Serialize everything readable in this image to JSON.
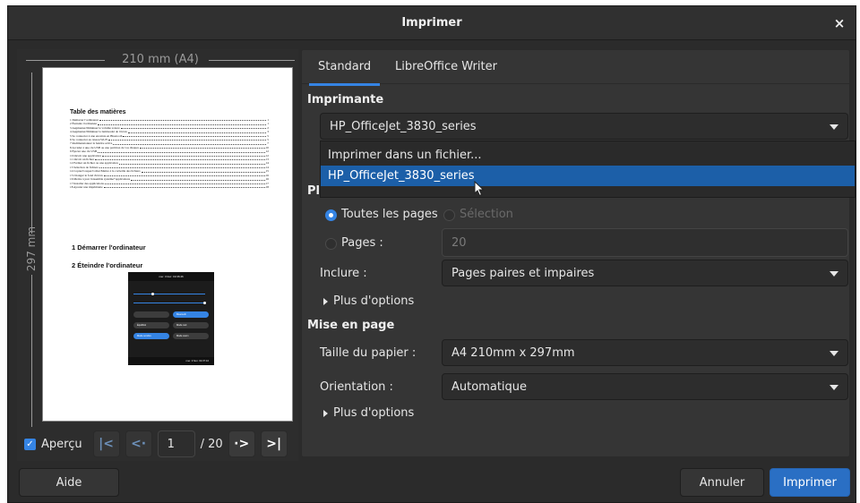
{
  "dialog": {
    "title": "Imprimer",
    "close_glyph": "×"
  },
  "preview": {
    "width_label": "210 mm (A4)",
    "height_label": "297 mm",
    "doc": {
      "toc_title": "Table des matières",
      "toc": [
        {
          "t": "1  Démarrer l'ordinateur",
          "p": "1"
        },
        {
          "t": "2  Éteindre l'ordinateur",
          "p": "1"
        },
        {
          "t": "3  Augmenter/Diminuer le volume sonore",
          "p": "2"
        },
        {
          "t": "4  Augmenter/Diminuer la luminosité de l'écran",
          "p": "3"
        },
        {
          "t": "5  Se connecter à une enceinte en Bluetooth",
          "p": "5"
        },
        {
          "t": "6  Se connecter au réseau Wi-Fi",
          "p": "5"
        },
        {
          "t": "7  Redimensionner la fenêtre active",
          "p": "7"
        },
        {
          "t": "8  Accéder à une clé USB ou une partition de vos disques",
          "p": "10"
        },
        {
          "t": "9  Éjecter une clé USB",
          "p": "12"
        },
        {
          "t": "10  Ouvrir une application",
          "p": "12"
        },
        {
          "t": "11  Ouvrir un fichier",
          "p": "13"
        },
        {
          "t": "12  Fermer un fichier ou une application",
          "p": "14"
        },
        {
          "t": "13  Sélection de fichiers",
          "p": "14"
        },
        {
          "t": "14  Copier/Couper/Coller/Mettre à la corbeille des fichiers",
          "p": "15"
        },
        {
          "t": "15  Changer le fond d'écran",
          "p": "16"
        },
        {
          "t": "16  Mettre à jour l'ensemble système+applications",
          "p": "16"
        },
        {
          "t": "17  Installer des applications",
          "p": "17"
        },
        {
          "t": "18  Ajouter une imprimante",
          "p": "18"
        }
      ],
      "heading1": "1   Démarrer l'ordinateur",
      "heading2": "2   Éteindre l'ordinateur",
      "shot_bar": "mer. 3 févr.  19:36:46",
      "shot_foot": "mer. 3 févr.  19:37:10",
      "shot_pills": [
        "Bluetooth",
        "Équilibré",
        "Mode nuit",
        "Mode sombre",
        "Mode avion"
      ]
    }
  },
  "nav": {
    "preview_label": "Aperçu",
    "current_page": "1",
    "of_pages": "/ 20"
  },
  "tabs": [
    "Standard",
    "LibreOffice Writer"
  ],
  "printer": {
    "section": "Imprimante",
    "selected": "HP_OfficeJet_3830_series",
    "options": [
      "Imprimer dans un fichier...",
      "HP_OfficeJet_3830_series"
    ],
    "hidden_section_initial": "Pl"
  },
  "range": {
    "all_pages_label": "Toutes les pages",
    "selection_label": "Sélection",
    "pages_label": "Pages :",
    "pages_value": "20",
    "include_label": "Inclure :",
    "include_value": "Pages paires et impaires",
    "more_options": "Plus d'options"
  },
  "layout": {
    "section": "Mise en page",
    "paper_label": "Taille du papier :",
    "paper_value": "A4 210mm x 297mm",
    "orientation_label": "Orientation :",
    "orientation_value": "Automatique",
    "more_options": "Plus d'options"
  },
  "buttons": {
    "help": "Aide",
    "cancel": "Annuler",
    "print": "Imprimer"
  },
  "colors": {
    "accent": "#3584e4",
    "selected_row": "#1c5fa8",
    "background": "#2b2b2b"
  }
}
